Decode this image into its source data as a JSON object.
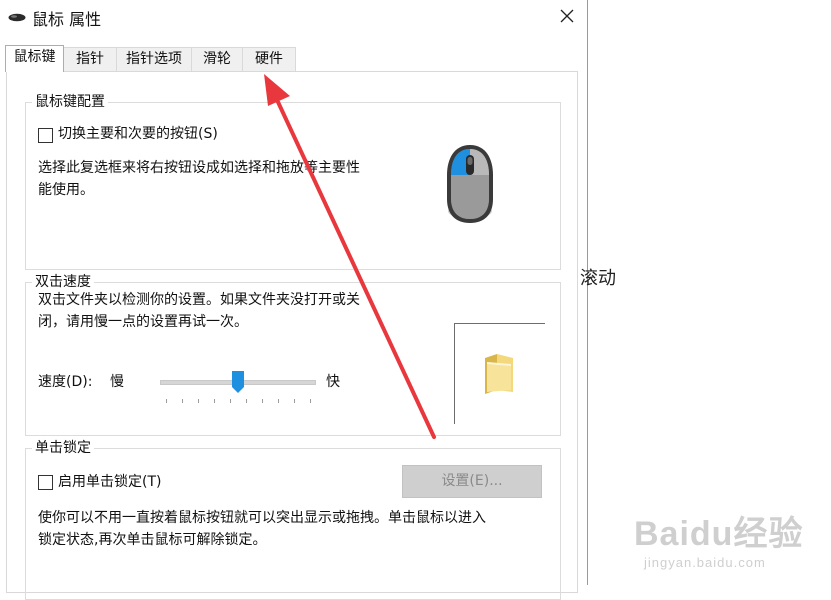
{
  "window": {
    "title": "鼠标 属性",
    "close_icon": "close-icon",
    "title_icon": "mouse-icon"
  },
  "tabs": [
    {
      "label": "鼠标键",
      "active": true
    },
    {
      "label": "指针",
      "active": false
    },
    {
      "label": "指针选项",
      "active": false
    },
    {
      "label": "滑轮",
      "active": false
    },
    {
      "label": "硬件",
      "active": false
    }
  ],
  "button_config": {
    "group_title": "鼠标键配置",
    "checkbox_label": "切换主要和次要的按钮(S)",
    "checked": false,
    "description_line1": "选择此复选框来将右按钮设成如选择和拖放等主要性",
    "description_line2": "能使用。"
  },
  "double_click": {
    "group_title": "双击速度",
    "description_line1": "双击文件夹以检测你的设置。如果文件夹没打开或关",
    "description_line2": "闭，请用慢一点的设置再试一次。",
    "speed_label": "速度(D):",
    "slow_label": "慢",
    "fast_label": "快",
    "slider_position": 0.5
  },
  "click_lock": {
    "group_title": "单击锁定",
    "checkbox_label": "启用单击锁定(T)",
    "checked": false,
    "settings_button": "设置(E)...",
    "description_line1": "使你可以不用一直按着鼠标按钮就可以突出显示或拖拽。单击鼠标以进入",
    "description_line2": "锁定状态,再次单击鼠标可解除锁定。"
  },
  "background": {
    "partial_text": "滚动"
  },
  "watermark": {
    "main": "Baidu经验",
    "sub": "jingyan.baidu.com"
  },
  "colors": {
    "accent_blue": "#1f8fe0",
    "arrow_red": "#e8383d",
    "disabled_button": "#cfcfcf"
  }
}
